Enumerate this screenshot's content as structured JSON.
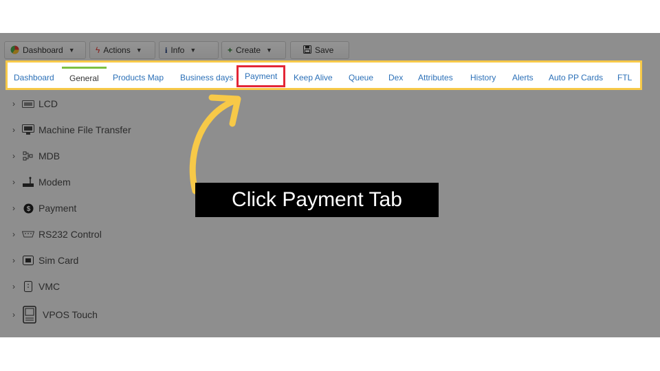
{
  "toolbar": {
    "dashboard": "Dashboard",
    "actions": "Actions",
    "info": "Info",
    "create": "Create",
    "save": "Save"
  },
  "tabs": [
    {
      "label": "Dashboard"
    },
    {
      "label": "General"
    },
    {
      "label": "Products Map"
    },
    {
      "label": "Business days"
    },
    {
      "label": "Payment"
    },
    {
      "label": "Keep Alive"
    },
    {
      "label": "Queue"
    },
    {
      "label": "Dex"
    },
    {
      "label": "Attributes"
    },
    {
      "label": "History"
    },
    {
      "label": "Alerts"
    },
    {
      "label": "Auto PP Cards"
    },
    {
      "label": "FTL"
    }
  ],
  "tree": [
    {
      "label": "LCD"
    },
    {
      "label": "Machine File Transfer"
    },
    {
      "label": "MDB"
    },
    {
      "label": "Modem"
    },
    {
      "label": "Payment"
    },
    {
      "label": "RS232 Control"
    },
    {
      "label": "Sim Card"
    },
    {
      "label": "VMC"
    },
    {
      "label": "VPOS Touch"
    }
  ],
  "callout": "Click Payment Tab",
  "colors": {
    "highlight_frame": "#f7c948",
    "highlight_tab": "#e32636",
    "active_tab_bar": "#7bc043",
    "link": "#2a6fb7",
    "arrow": "#f7c948"
  }
}
